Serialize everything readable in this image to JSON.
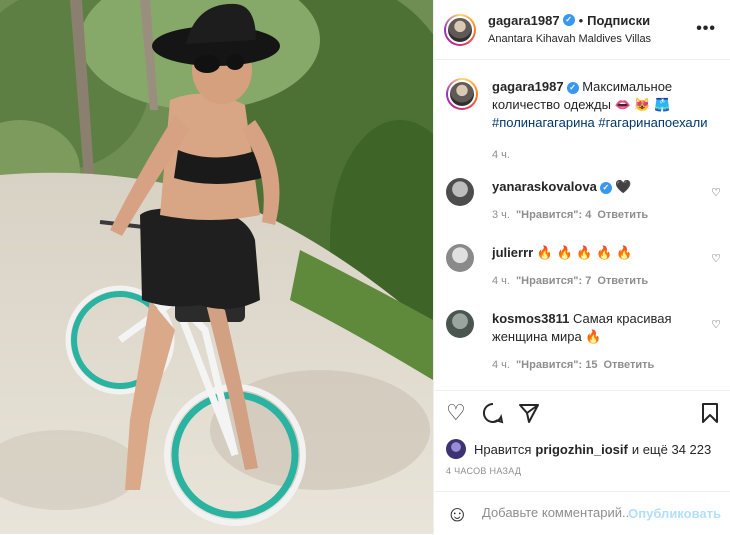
{
  "post": {
    "author": "gagara1987",
    "follow_label": "Подписки",
    "separator": "•",
    "location": "Anantara Kihavah Maldives Villas",
    "more_label": "•••",
    "verified_mark": "✓"
  },
  "caption": {
    "author": "gagara1987",
    "text": "Максимальное количество одежды 👄 😻 🩳",
    "hashtags": "#полинагагарина #гагаринапоехали",
    "time": "4 ч."
  },
  "comments": [
    {
      "author": "yanaraskovalova",
      "verified": true,
      "text": "🖤",
      "time": "3 ч.",
      "likes": "\"Нравится\": 4",
      "reply": "Ответить"
    },
    {
      "author": "julierrr",
      "verified": false,
      "text": "🔥 🔥 🔥 🔥 🔥",
      "time": "4 ч.",
      "likes": "\"Нравится\": 7",
      "reply": "Ответить"
    },
    {
      "author": "kosmos3811",
      "verified": false,
      "text": "Самая красивая женщина мира 🔥",
      "time": "4 ч.",
      "likes": "\"Нравится\": 15",
      "reply": "Ответить"
    }
  ],
  "actions": {
    "like_icon": "heart-icon",
    "comment_icon": "comment-icon",
    "share_icon": "share-icon",
    "save_icon": "bookmark-icon"
  },
  "likes": {
    "prefix": "Нравится",
    "user": "prigozhin_iosif",
    "suffix": "и ещё 34 223"
  },
  "timestamp": "4 ЧАСОВ НАЗАД",
  "add_comment": {
    "placeholder": "Добавьте комментарий...",
    "publish_label": "Опубликовать"
  },
  "colors": {
    "verified": "#3897f0",
    "link": "#00376b",
    "publish_disabled": "#b2dffc",
    "muted": "#8e8e8e"
  }
}
